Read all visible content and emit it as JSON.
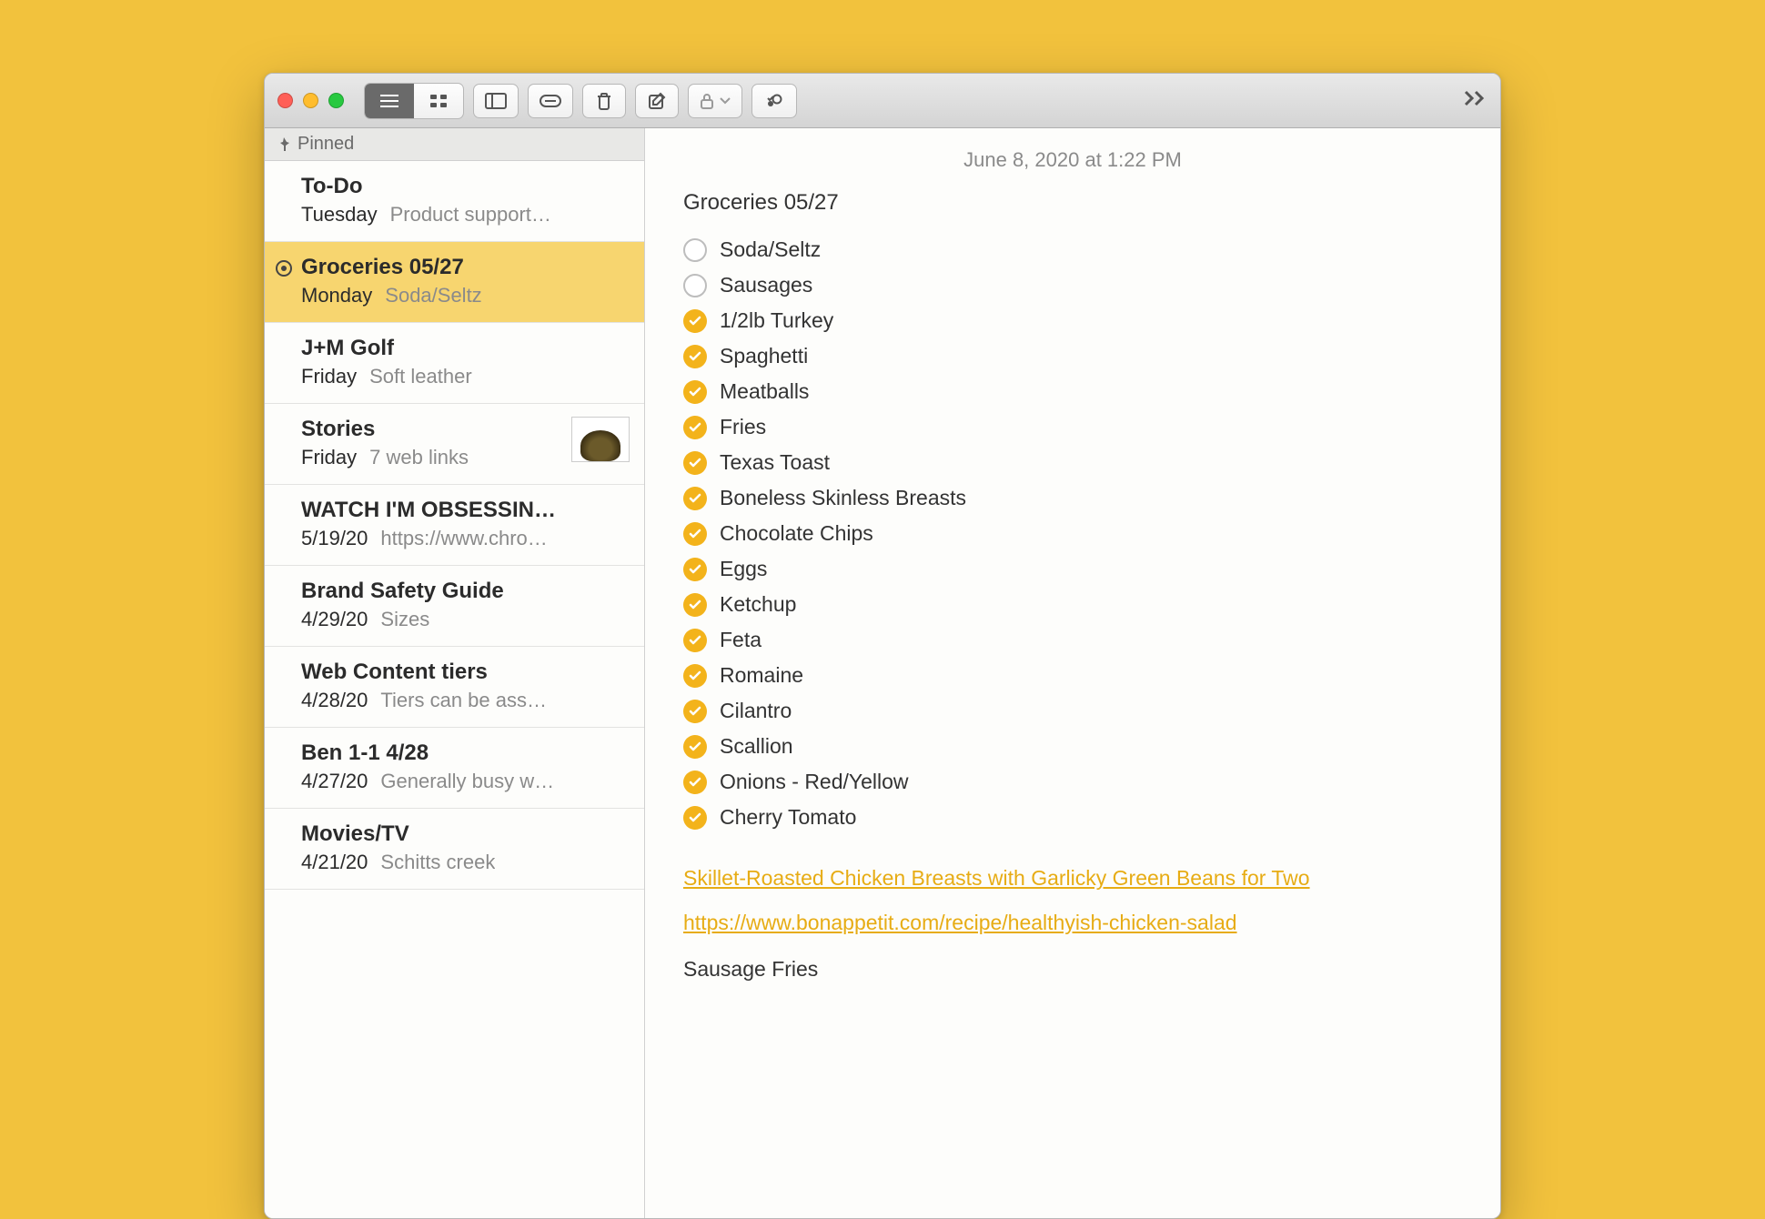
{
  "colors": {
    "accent": "#f3b31b",
    "selection": "#f7d56f",
    "link": "#e7ac14"
  },
  "toolbar": {
    "view_list_label": "List view",
    "view_grid_label": "Gallery view",
    "folders_label": "Show folders",
    "attach_label": "Attachments",
    "delete_label": "Delete note",
    "compose_label": "New note",
    "lock_label": "Lock note",
    "share_label": "Share / collaborate",
    "more_label": "More"
  },
  "sidebar": {
    "pinned_label": "Pinned",
    "notes": [
      {
        "title": "To-Do",
        "date": "Tuesday",
        "preview": "Product support…",
        "selected": false,
        "shared": false,
        "thumb": false
      },
      {
        "title": "Groceries 05/27",
        "date": "Monday",
        "preview": "Soda/Seltz",
        "selected": true,
        "shared": true,
        "thumb": false
      },
      {
        "title": "J+M Golf",
        "date": "Friday",
        "preview": "Soft leather",
        "selected": false,
        "shared": false,
        "thumb": false
      },
      {
        "title": "Stories",
        "date": "Friday",
        "preview": "7 web links",
        "selected": false,
        "shared": false,
        "thumb": true
      },
      {
        "title": "WATCH I'M OBSESSIN…",
        "date": "5/19/20",
        "preview": "https://www.chro…",
        "selected": false,
        "shared": false,
        "thumb": false
      },
      {
        "title": "Brand Safety Guide",
        "date": "4/29/20",
        "preview": "Sizes",
        "selected": false,
        "shared": false,
        "thumb": false
      },
      {
        "title": "Web Content tiers",
        "date": "4/28/20",
        "preview": "Tiers can be ass…",
        "selected": false,
        "shared": false,
        "thumb": false
      },
      {
        "title": "Ben 1-1 4/28",
        "date": "4/27/20",
        "preview": "Generally busy w…",
        "selected": false,
        "shared": false,
        "thumb": false
      },
      {
        "title": "Movies/TV",
        "date": "4/21/20",
        "preview": "Schitts creek",
        "selected": false,
        "shared": false,
        "thumb": false
      }
    ]
  },
  "note": {
    "timestamp": "June 8, 2020 at 1:22 PM",
    "title": "Groceries 05/27",
    "checklist": [
      {
        "text": "Soda/Seltz",
        "checked": false
      },
      {
        "text": "Sausages",
        "checked": false
      },
      {
        "text": "1/2lb Turkey",
        "checked": true
      },
      {
        "text": "Spaghetti",
        "checked": true
      },
      {
        "text": "Meatballs",
        "checked": true
      },
      {
        "text": "Fries",
        "checked": true
      },
      {
        "text": "Texas Toast",
        "checked": true
      },
      {
        "text": "Boneless Skinless Breasts",
        "checked": true
      },
      {
        "text": "Chocolate Chips",
        "checked": true
      },
      {
        "text": "Eggs",
        "checked": true
      },
      {
        "text": "Ketchup",
        "checked": true
      },
      {
        "text": "Feta",
        "checked": true
      },
      {
        "text": "Romaine",
        "checked": true
      },
      {
        "text": "Cilantro",
        "checked": true
      },
      {
        "text": "Scallion",
        "checked": true
      },
      {
        "text": "Onions - Red/Yellow",
        "checked": true
      },
      {
        "text": "Cherry Tomato",
        "checked": true
      }
    ],
    "links": [
      "Skillet-Roasted Chicken Breasts with Garlicky Green Beans for Two",
      "https://www.bonappetit.com/recipe/healthyish-chicken-salad"
    ],
    "extra": "Sausage Fries"
  }
}
